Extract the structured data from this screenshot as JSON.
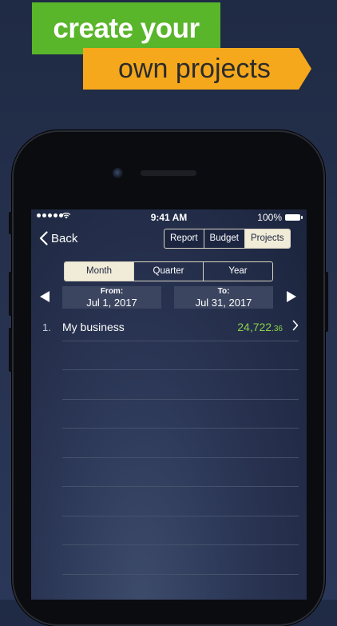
{
  "promo": {
    "line1": "create your",
    "line2": "own projects"
  },
  "status_bar": {
    "time": "9:41 AM",
    "battery": "100%"
  },
  "nav": {
    "back_label": "Back",
    "tabs": [
      {
        "label": "Report",
        "active": false
      },
      {
        "label": "Budget",
        "active": false
      },
      {
        "label": "Projects",
        "active": true
      }
    ]
  },
  "period": {
    "options": [
      {
        "label": "Month",
        "active": true
      },
      {
        "label": "Quarter",
        "active": false
      },
      {
        "label": "Year",
        "active": false
      }
    ]
  },
  "range": {
    "from_label": "From:",
    "from_value": "Jul 1, 2017",
    "to_label": "To:",
    "to_value": "Jul 31, 2017"
  },
  "projects": [
    {
      "index": "1.",
      "name": "My business",
      "amount_main": "24,722",
      "amount_cents": ".36"
    }
  ],
  "colors": {
    "accent_green": "#8bd14a",
    "banner_green": "#59b52a",
    "banner_orange": "#f5a81c",
    "segment_active": "#f1ecd7"
  }
}
